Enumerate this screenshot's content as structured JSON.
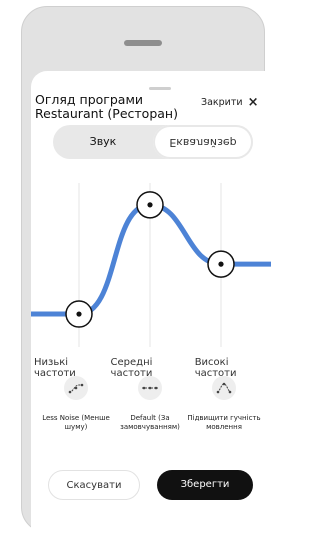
{
  "dialog": {
    "title": "Огляд програми Restaurant (Ресторан)",
    "close_label": "Закрити"
  },
  "tabs": {
    "sound": "Звук",
    "screen": "Еквалайзер"
  },
  "equalizer": {
    "bands": [
      {
        "label": "Низькі частоти",
        "level": 0.16
      },
      {
        "label": "Середні частоти",
        "level": 0.86
      },
      {
        "label": "Високі частоти",
        "level": 0.48
      }
    ]
  },
  "presets": [
    {
      "label": "Less Noise (Менше шуму)",
      "icon": "less-noise-icon"
    },
    {
      "label": "Default (За замовчуванням)",
      "icon": "default-icon"
    },
    {
      "label": "Підвищити гучність мовлення",
      "icon": "boost-speech-icon"
    }
  ],
  "footer": {
    "cancel": "Скасувати",
    "save": "Зберегти"
  },
  "colors": {
    "curve": "#4d83d6",
    "primary_button": "#111111"
  }
}
